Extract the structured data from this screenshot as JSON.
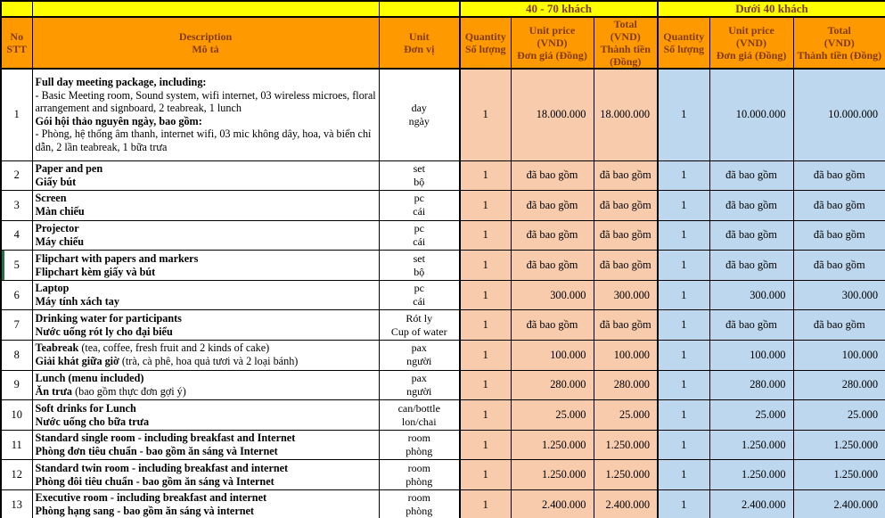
{
  "colors": {
    "band_bg": "#FFFF00",
    "header_bg": "#FF9900",
    "header_text": "#833C00",
    "group1_bg": "#F8CBAD",
    "group2_bg": "#BDD7EE",
    "border": "#000000",
    "row5_edge_mark": "#217346"
  },
  "groups": [
    {
      "label": "40 - 70 khách"
    },
    {
      "label": "Dưới 40 khách"
    }
  ],
  "headers": {
    "no": [
      "No",
      "STT"
    ],
    "description": [
      "Description",
      "Mô tả"
    ],
    "unit": [
      "Unit",
      "Đơn vị"
    ],
    "quantity": [
      "Quantity",
      "Số lượng"
    ],
    "unit_price": [
      "Unit price",
      "(VND)",
      "Đơn giá (Đồng)"
    ],
    "total_narrow": [
      "Total",
      "(VND)",
      "Thành tiền",
      "(Đồng)"
    ],
    "total_wide": [
      "Total",
      "(VND)",
      "Thành tiền (Đồng)"
    ]
  },
  "included_label": "đã bao gồm",
  "rows": [
    {
      "no": "1",
      "description": [
        [
          {
            "t": "Full day meeting package, including:",
            "b": 1
          }
        ],
        [
          {
            "t": "- Basic Meeting room, Sound system, wifi internet, 03 wireless microes, floral arrangement and signboard, 2 teabreak, 1 lunch",
            "b": 0
          }
        ],
        [
          {
            "t": "Gói hội thảo nguyên ngày, bao gồm:",
            "b": 1
          }
        ],
        [
          {
            "t": "- Phòng, hệ thống âm thanh, internet wifi, 03 mic không dây, hoa, và biển chỉ dẫn, 2 lần teabreak, 1 bữa trưa",
            "b": 0
          }
        ]
      ],
      "unit": [
        "day",
        "ngày"
      ],
      "g1": {
        "qty": "1",
        "price": "18.000.000",
        "total": "18.000.000"
      },
      "g2": {
        "qty": "1",
        "price": "10.000.000",
        "total": "10.000.000"
      }
    },
    {
      "no": "2",
      "description": [
        [
          {
            "t": "Paper and pen",
            "b": 1
          }
        ],
        [
          {
            "t": "Giấy bút",
            "b": 1
          }
        ]
      ],
      "unit": [
        "set",
        "bộ"
      ],
      "g1": {
        "qty": "1",
        "price": "đã bao gồm",
        "total": "đã bao gồm"
      },
      "g2": {
        "qty": "1",
        "price": "đã bao gồm",
        "total": "đã bao gồm"
      }
    },
    {
      "no": "3",
      "description": [
        [
          {
            "t": "Screen",
            "b": 1
          }
        ],
        [
          {
            "t": "Màn chiếu",
            "b": 1
          }
        ]
      ],
      "unit": [
        "pc",
        "cái"
      ],
      "g1": {
        "qty": "1",
        "price": "đã bao gồm",
        "total": "đã bao gồm"
      },
      "g2": {
        "qty": "1",
        "price": "đã bao gồm",
        "total": "đã bao gồm"
      }
    },
    {
      "no": "4",
      "description": [
        [
          {
            "t": "Projector",
            "b": 1
          }
        ],
        [
          {
            "t": "Máy chiếu",
            "b": 1
          }
        ]
      ],
      "unit": [
        "pc",
        "cái"
      ],
      "g1": {
        "qty": "1",
        "price": "đã bao gồm",
        "total": "đã bao gồm"
      },
      "g2": {
        "qty": "1",
        "price": "đã bao gồm",
        "total": "đã bao gồm"
      }
    },
    {
      "no": "5",
      "green_left_border": true,
      "description": [
        [
          {
            "t": "Flipchart with papers and markers",
            "b": 1
          }
        ],
        [
          {
            "t": "Flipchart kèm giấy và bút",
            "b": 1
          }
        ]
      ],
      "unit": [
        "set",
        "bộ"
      ],
      "g1": {
        "qty": "1",
        "price": "đã bao gồm",
        "total": "đã bao gồm"
      },
      "g2": {
        "qty": "1",
        "price": "đã bao gồm",
        "total": "đã bao gồm"
      }
    },
    {
      "no": "6",
      "description": [
        [
          {
            "t": "Laptop",
            "b": 1
          }
        ],
        [
          {
            "t": "Máy tính xách tay",
            "b": 1
          }
        ]
      ],
      "unit": [
        "pc",
        "cái"
      ],
      "g1": {
        "qty": "1",
        "price": "300.000",
        "total": "300.000"
      },
      "g2": {
        "qty": "1",
        "price": "300.000",
        "total": "300.000"
      }
    },
    {
      "no": "7",
      "description": [
        [
          {
            "t": "Drinking water for participants",
            "b": 1
          }
        ],
        [
          {
            "t": "Nước uống rót ly cho đại biểu",
            "b": 1
          }
        ]
      ],
      "unit": [
        "Rót ly",
        "Cup of water"
      ],
      "g1": {
        "qty": "1",
        "price": "đã bao gồm",
        "total": "đã bao gồm"
      },
      "g2": {
        "qty": "1",
        "price": "đã bao gồm",
        "total": "đã bao gồm"
      }
    },
    {
      "no": "8",
      "description": [
        [
          {
            "t": "Teabreak",
            "b": 1
          },
          {
            "t": " (tea, coffee, fresh fruit and 2 kinds of cake)",
            "b": 0
          }
        ],
        [
          {
            "t": "Giải khát giữa giờ",
            "b": 1
          },
          {
            "t": " (trà, cà phê, hoa quả tươi và 2 loại bánh)",
            "b": 0
          }
        ]
      ],
      "unit": [
        "pax",
        "người"
      ],
      "g1": {
        "qty": "1",
        "price": "100.000",
        "total": "100.000"
      },
      "g2": {
        "qty": "1",
        "price": "100.000",
        "total": "100.000"
      }
    },
    {
      "no": "9",
      "description": [
        [
          {
            "t": "Lunch (menu included)",
            "b": 1
          }
        ],
        [
          {
            "t": "Ăn trưa",
            "b": 1
          },
          {
            "t": " (bao gồm thực đơn gợi ý)",
            "b": 0
          }
        ]
      ],
      "unit": [
        "pax",
        "người"
      ],
      "g1": {
        "qty": "1",
        "price": "280.000",
        "total": "280.000"
      },
      "g2": {
        "qty": "1",
        "price": "280.000",
        "total": "280.000"
      }
    },
    {
      "no": "10",
      "description": [
        [
          {
            "t": "Soft drinks for Lunch",
            "b": 1
          }
        ],
        [
          {
            "t": "Nước uống cho bữa trưa",
            "b": 1
          }
        ]
      ],
      "unit": [
        "can/bottle",
        "lon/chai"
      ],
      "g1": {
        "qty": "1",
        "price": "25.000",
        "total": "25.000"
      },
      "g2": {
        "qty": "1",
        "price": "25.000",
        "total": "25.000"
      }
    },
    {
      "no": "11",
      "description": [
        [
          {
            "t": "Standard single room - including breakfast and Internet",
            "b": 1
          }
        ],
        [
          {
            "t": "Phòng đơn tiêu chuẩn - bao gồm ăn sáng và Internet",
            "b": 1
          }
        ]
      ],
      "unit": [
        "room",
        "phòng"
      ],
      "g1": {
        "qty": "1",
        "price": "1.250.000",
        "total": "1.250.000"
      },
      "g2": {
        "qty": "1",
        "price": "1.250.000",
        "total": "1.250.000"
      }
    },
    {
      "no": "12",
      "description": [
        [
          {
            "t": "Standard twin room - including breakfast and internet",
            "b": 1
          }
        ],
        [
          {
            "t": "Phòng đôi tiêu chuẩn - bao gồm ăn sáng và Internet",
            "b": 1
          }
        ]
      ],
      "unit": [
        "room",
        "phòng"
      ],
      "g1": {
        "qty": "1",
        "price": "1.250.000",
        "total": "1.250.000"
      },
      "g2": {
        "qty": "1",
        "price": "1.250.000",
        "total": "1.250.000"
      }
    },
    {
      "no": "13",
      "description": [
        [
          {
            "t": "Executive room - including breakfast and internet",
            "b": 1
          }
        ],
        [
          {
            "t": "Phòng hạng sang - bao gồm ăn sáng và internet",
            "b": 1
          }
        ]
      ],
      "unit": [
        "room",
        "phòng"
      ],
      "g1": {
        "qty": "1",
        "price": "2.400.000",
        "total": "2.400.000"
      },
      "g2": {
        "qty": "1",
        "price": "2.400.000",
        "total": "2.400.000"
      }
    }
  ]
}
